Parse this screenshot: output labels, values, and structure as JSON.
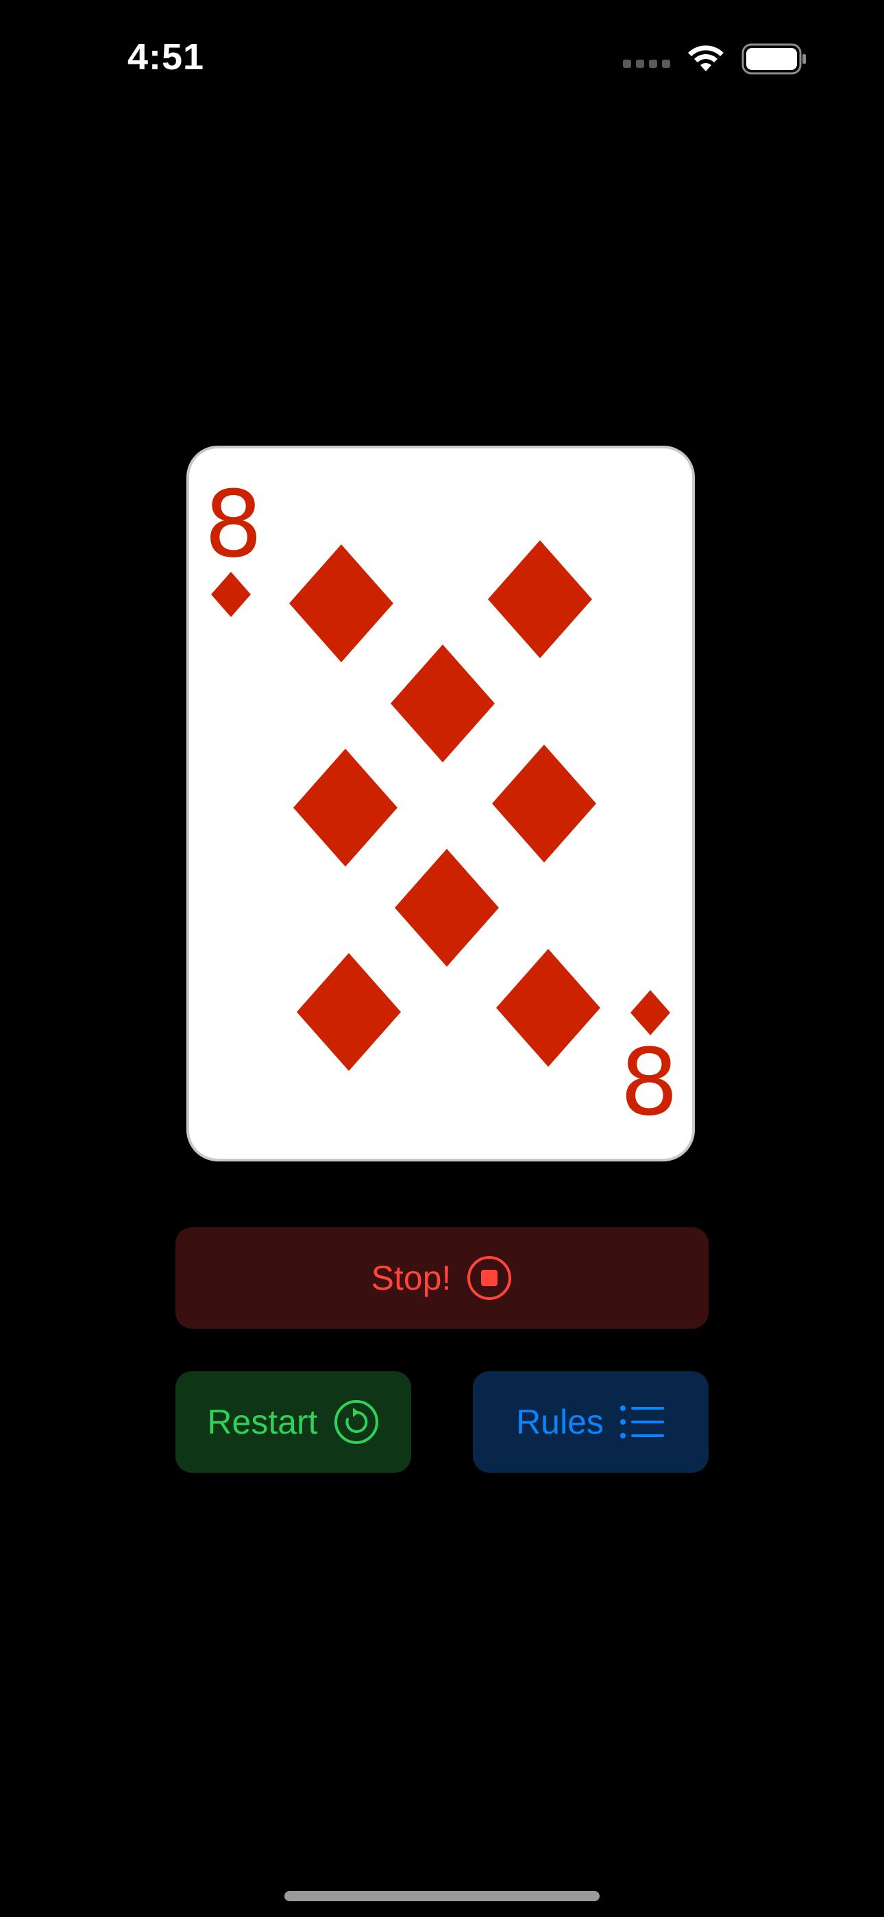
{
  "status_bar": {
    "time": "4:51",
    "icons": [
      "signal-dots-icon",
      "wifi-icon",
      "battery-icon"
    ]
  },
  "card": {
    "rank": "8",
    "suit": "diamonds",
    "suit_color": "#cc2200",
    "pip_count": 8
  },
  "buttons": {
    "stop": {
      "label": "Stop!",
      "icon": "stop-circle-icon",
      "color": "#ff453a",
      "background": "#3a0f10"
    },
    "restart": {
      "label": "Restart",
      "icon": "restart-circle-icon",
      "color": "#30d158",
      "background": "#0f3517"
    },
    "rules": {
      "label": "Rules",
      "icon": "list-bullet-icon",
      "color": "#0a84ff",
      "background": "#072649"
    }
  }
}
